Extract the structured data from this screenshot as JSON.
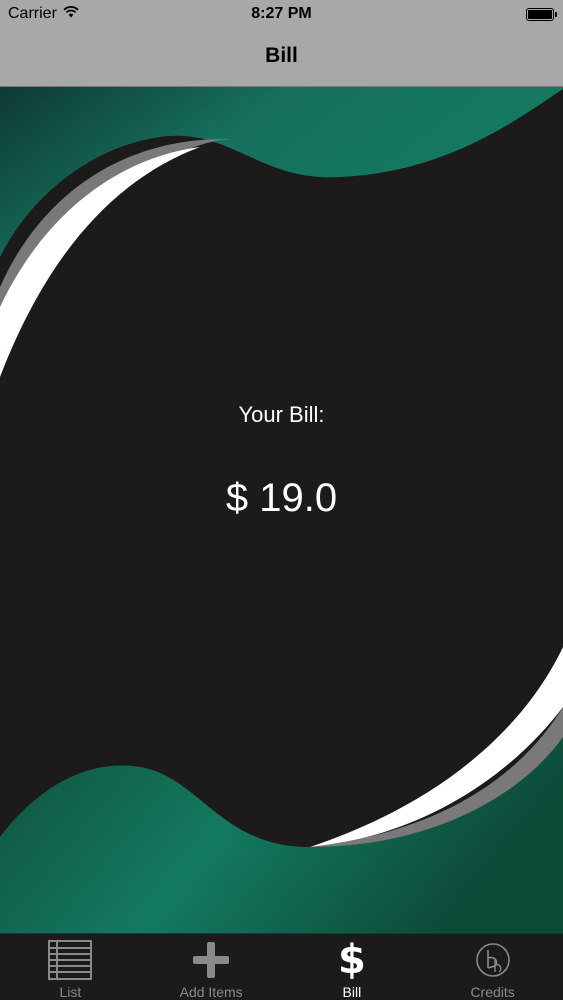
{
  "status_bar": {
    "carrier": "Carrier",
    "time": "8:27 PM"
  },
  "nav": {
    "title": "Bill"
  },
  "bill": {
    "label": "Your Bill:",
    "amount": "$ 19.0"
  },
  "tabs": [
    {
      "label": "List",
      "icon": "list-icon",
      "active": false
    },
    {
      "label": "Add Items",
      "icon": "plus-icon",
      "active": false
    },
    {
      "label": "Bill",
      "icon": "dollar-icon",
      "active": true
    },
    {
      "label": "Credits",
      "icon": "credits-icon",
      "active": false
    }
  ],
  "colors": {
    "bar_gray": "#a8a8a8",
    "background_dark": "#1c1a1b",
    "accent_green": "#137a62",
    "tab_bar": "#1b1b1b",
    "tab_inactive": "#8a8a8a",
    "tab_active": "#ffffff"
  }
}
